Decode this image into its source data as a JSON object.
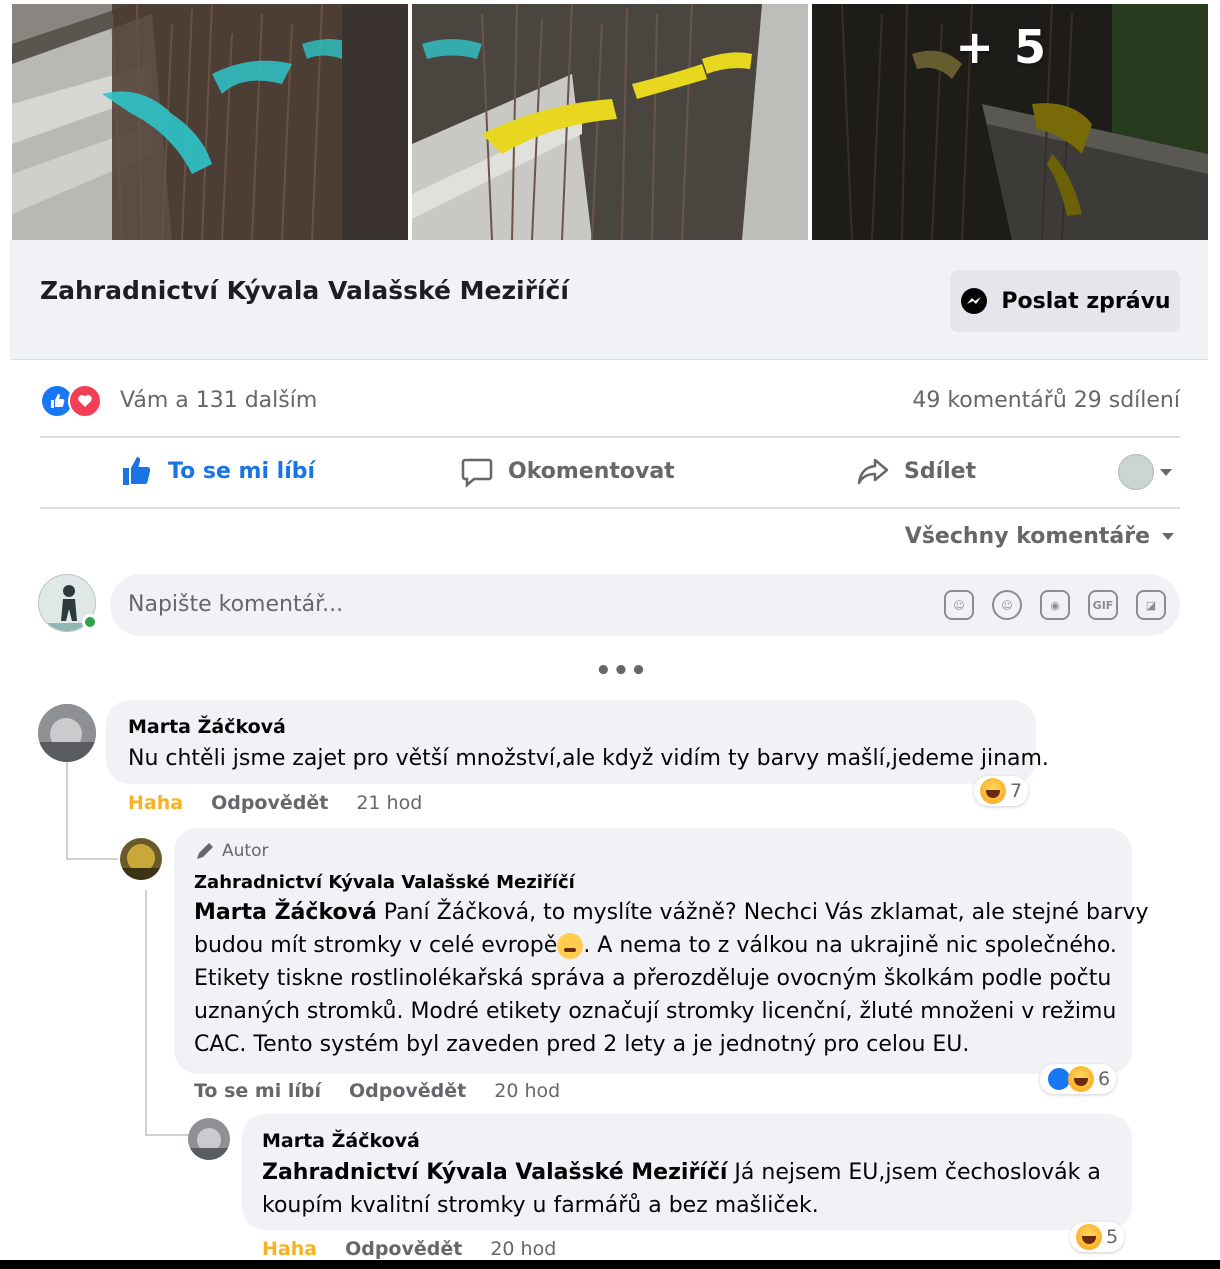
{
  "photos": {
    "more_count": "+ 5"
  },
  "page": {
    "name": "Zahradnictví Kývala Valašské Meziříčí",
    "message_button": "Poslat zprávu"
  },
  "stats": {
    "reactions_text": "Vám a 131 dalším",
    "comments_shares": "49 komentářů  29 sdílení"
  },
  "actions": {
    "like": "To se mi líbí",
    "comment": "Okomentovat",
    "share": "Sdílet"
  },
  "filter": {
    "label": "Všechny komentáře"
  },
  "composer": {
    "placeholder": "Napište komentář..."
  },
  "more_dots": "•••",
  "comments": [
    {
      "author": "Marta Žáčková",
      "text": "Nu chtěli jsme zajet pro větší množství,ale když vidím ty barvy mašlí,jedeme jinam.",
      "action1": "Haha",
      "reply": "Odpovědět",
      "time": "21 hod",
      "reaction_count": "7"
    },
    {
      "author_tag": "Autor",
      "author": "Zahradnictví Kývala Valašské Meziříčí",
      "mention": "Marta Žáčková",
      "text_line1": " Paní Žáčková, to myslíte vážně? Nechci Vás zklamat, ale stejné barvy",
      "text_line2a": "budou mít stromky v celé evropě",
      "text_line2b": ". A nema to z válkou na ukrajině nic společného.",
      "text_line3": "Etikety tiskne rostlinolékařská správa a přerozděluje ovocným školkám podle počtu",
      "text_line4": "uznaných stromků. Modré etikety označují stromky licenční, žluté množeni v režimu",
      "text_line5": "CAC. Tento systém byl zaveden pred 2 lety a je jednotný pro celou EU.",
      "action1": "To se mi líbí",
      "reply": "Odpovědět",
      "time": "20 hod",
      "reaction_count": "6"
    },
    {
      "author": "Marta Žáčková",
      "mention": "Zahradnictví Kývala Valašské Meziříčí",
      "text_line1": " Já nejsem EU,jsem čechoslovák a",
      "text_line2": "koupím kvalitní stromky u farmářů a bez mašliček.",
      "action1": "Haha",
      "reply": "Odpovědět",
      "time": "20 hod",
      "reaction_count": "5"
    }
  ],
  "colors": {
    "facebook_blue": "#1877f2",
    "love_red": "#f33e58",
    "haha_yellow": "#f7b125",
    "gray_text": "#65676b",
    "bubble_bg": "#f0f2f5",
    "ribbon_blue": "#2ec4c8",
    "ribbon_yellow": "#e7d81f"
  },
  "icons": [
    "messenger-icon",
    "like-icon",
    "love-icon",
    "comment-icon",
    "share-icon",
    "sticker-icon",
    "emoji-icon",
    "camera-icon",
    "gif-icon",
    "avatar-sticker-icon",
    "pencil-icon",
    "haha-icon"
  ]
}
